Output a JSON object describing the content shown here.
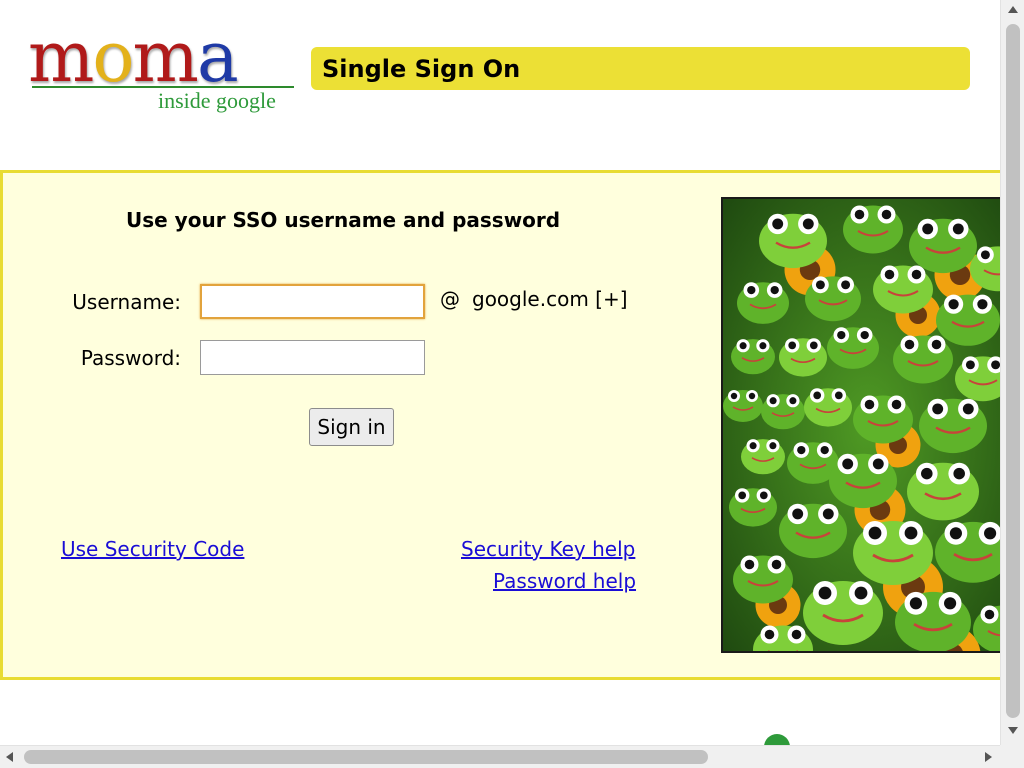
{
  "header": {
    "logo": {
      "letters": [
        "m",
        "o",
        "m",
        "a"
      ],
      "subtitle": "inside google"
    },
    "title": "Single Sign On"
  },
  "login": {
    "heading": "Use your SSO username and password",
    "username_label": "Username:",
    "password_label": "Password:",
    "username_value": "",
    "password_value": "",
    "domain_at": "@",
    "domain": "google.com [+]",
    "sign_in_label": "Sign in"
  },
  "links": {
    "security_code": "Use Security Code",
    "security_key_help": "Security Key help",
    "password_help": "Password help"
  },
  "photo": {
    "subject": "green frog figurines with sunflowers"
  },
  "colors": {
    "title_bar": "#ece035",
    "panel_background": "#ffffdd",
    "panel_border": "#e8dc32",
    "link": "#1a0dd6",
    "logo_red": "#b01a1a",
    "logo_yellow": "#e3b11b",
    "logo_blue": "#1f3aa6",
    "logo_green": "#2e9a3a"
  }
}
